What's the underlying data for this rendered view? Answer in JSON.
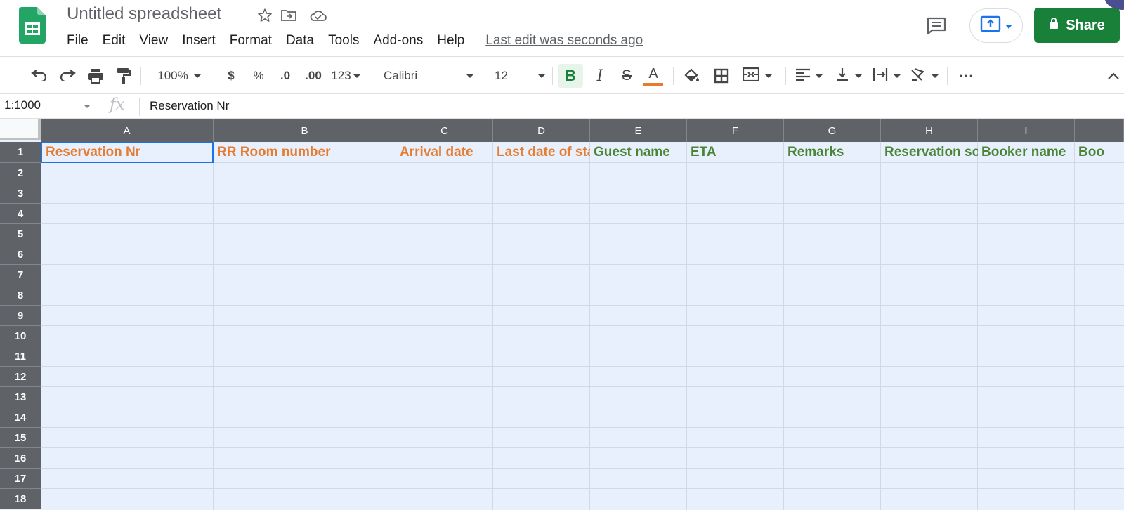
{
  "header": {
    "doc_title": "Untitled spreadsheet",
    "menus": [
      "File",
      "Edit",
      "View",
      "Insert",
      "Format",
      "Data",
      "Tools",
      "Add-ons",
      "Help"
    ],
    "last_edit": "Last edit was seconds ago",
    "share_label": "Share"
  },
  "toolbar": {
    "zoom": "100%",
    "currency": "$",
    "percent": "%",
    "decrease_decimals": ".0",
    "increase_decimals": ".00",
    "more_formats": "123",
    "font": "Calibri",
    "font_size": "12",
    "bold": "B",
    "italic": "I",
    "strikethrough": "S",
    "text_color": "A",
    "more": "⋯"
  },
  "formula_bar": {
    "name_box": "1:1000",
    "fx": "fx",
    "value": "Reservation Nr"
  },
  "grid": {
    "columns": [
      "A",
      "B",
      "C",
      "D",
      "E",
      "F",
      "G",
      "H",
      "I",
      ""
    ],
    "rows": [
      "1",
      "2",
      "3",
      "4",
      "5",
      "6",
      "7",
      "8",
      "9",
      "10",
      "11",
      "12",
      "13",
      "14",
      "15",
      "16",
      "17",
      "18"
    ],
    "row1_cells": [
      {
        "text": "Reservation Nr",
        "color": "#e67c30"
      },
      {
        "text": "RR Room number",
        "color": "#e67c30"
      },
      {
        "text": "Arrival date",
        "color": "#e67c30"
      },
      {
        "text": "Last date of sta",
        "color": "#e67c30"
      },
      {
        "text": "Guest name",
        "color": "#4a8535"
      },
      {
        "text": "ETA",
        "color": "#4a8535"
      },
      {
        "text": "Remarks",
        "color": "#4a8535"
      },
      {
        "text": "Reservation so",
        "color": "#4a8535"
      },
      {
        "text": "Booker name",
        "color": "#4a8535"
      },
      {
        "text": "Boo",
        "color": "#4a8535"
      }
    ],
    "selection_color": "#1a73e8",
    "sheet_fill": "#e8f0fd",
    "header_fill": "#5f6368"
  },
  "colors": {
    "brand_green": "#188038",
    "text_color_underline": "#e67c30"
  }
}
